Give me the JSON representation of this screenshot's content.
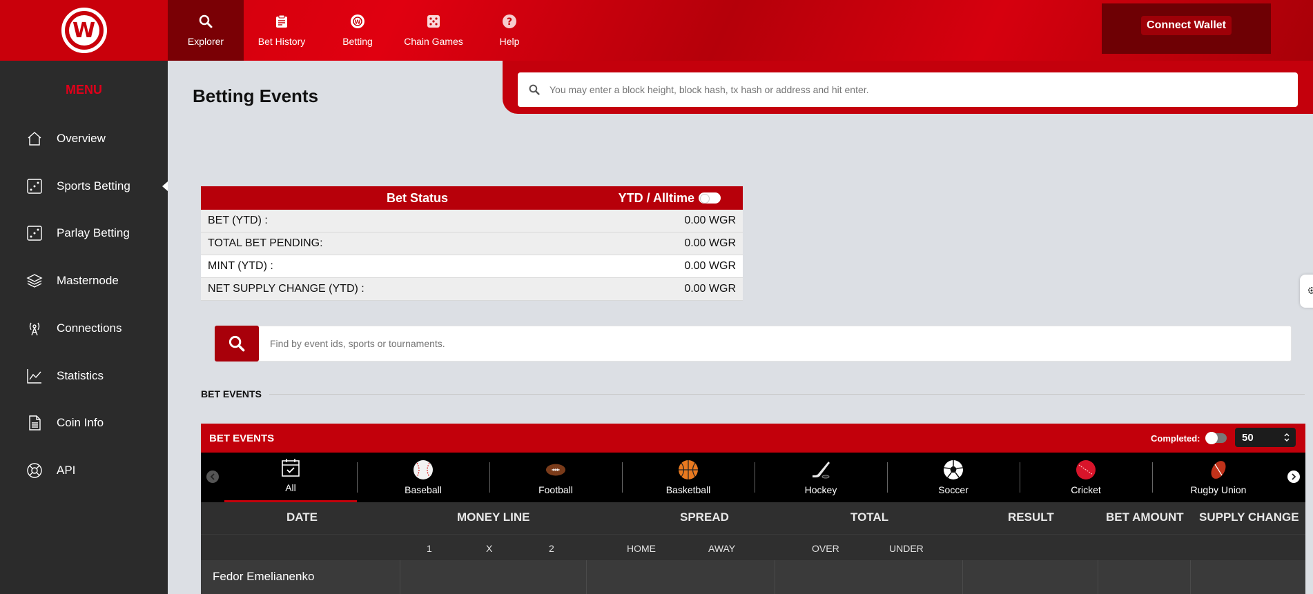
{
  "nav": {
    "items": [
      {
        "label": "Explorer",
        "icon": "search-icon"
      },
      {
        "label": "Bet History",
        "icon": "clipboard-icon"
      },
      {
        "label": "Betting",
        "icon": "wagerr-coin-icon"
      },
      {
        "label": "Chain Games",
        "icon": "dice-icon"
      },
      {
        "label": "Help",
        "icon": "help-icon"
      }
    ],
    "connect_wallet": "Connect Wallet"
  },
  "sidebar": {
    "menu_title": "MENU",
    "items": [
      {
        "label": "Overview",
        "icon": "home-icon"
      },
      {
        "label": "Sports Betting",
        "icon": "dice-icon"
      },
      {
        "label": "Parlay Betting",
        "icon": "dice-icon"
      },
      {
        "label": "Masternode",
        "icon": "layers-icon"
      },
      {
        "label": "Connections",
        "icon": "antenna-icon"
      },
      {
        "label": "Statistics",
        "icon": "chart-icon"
      },
      {
        "label": "Coin Info",
        "icon": "document-icon"
      },
      {
        "label": "API",
        "icon": "lifebuoy-icon"
      }
    ]
  },
  "page": {
    "title": "Betting Events",
    "search_placeholder": "You may enter a block height, block hash, tx hash or address and hit enter."
  },
  "bet_status": {
    "title": "Bet Status",
    "toggle_label": "YTD / Alltime",
    "rows": [
      {
        "label": "BET (YTD) :",
        "value": "0.00 WGR"
      },
      {
        "label": "TOTAL BET PENDING:",
        "value": "0.00 WGR"
      },
      {
        "label": "MINT (YTD) :",
        "value": "0.00 WGR"
      },
      {
        "label": "NET SUPPLY CHANGE (YTD) :",
        "value": "0.00 WGR"
      }
    ]
  },
  "event_search": {
    "placeholder": "Find by event ids, sports or tournaments."
  },
  "section_label": "BET EVENTS",
  "bet_events": {
    "title": "BET EVENTS",
    "completed_label": "Completed:",
    "per_page": "50",
    "sports": [
      {
        "label": "All",
        "icon": "calendar-icon"
      },
      {
        "label": "Baseball",
        "icon": "baseball-icon"
      },
      {
        "label": "Football",
        "icon": "football-icon"
      },
      {
        "label": "Basketball",
        "icon": "basketball-icon"
      },
      {
        "label": "Hockey",
        "icon": "hockey-icon"
      },
      {
        "label": "Soccer",
        "icon": "soccer-icon"
      },
      {
        "label": "Cricket",
        "icon": "cricket-icon"
      },
      {
        "label": "Rugby Union",
        "icon": "rugby-icon"
      }
    ],
    "columns": {
      "date": "DATE",
      "money_line": "MONEY LINE",
      "spread": "SPREAD",
      "total": "TOTAL",
      "result": "RESULT",
      "bet_amount": "BET AMOUNT",
      "supply_change": "SUPPLY CHANGE"
    },
    "subcolumns": {
      "ml_1": "1",
      "ml_x": "X",
      "ml_2": "2",
      "home": "HOME",
      "away": "AWAY",
      "over": "OVER",
      "under": "UNDER"
    },
    "rows": [
      {
        "event": "Fedor Emelianenko"
      }
    ]
  },
  "colors": {
    "brand_red": "#c2000b",
    "dark_red": "#7a0005",
    "sidebar_bg": "#2b2b2b",
    "page_bg": "#dcdfe4"
  }
}
